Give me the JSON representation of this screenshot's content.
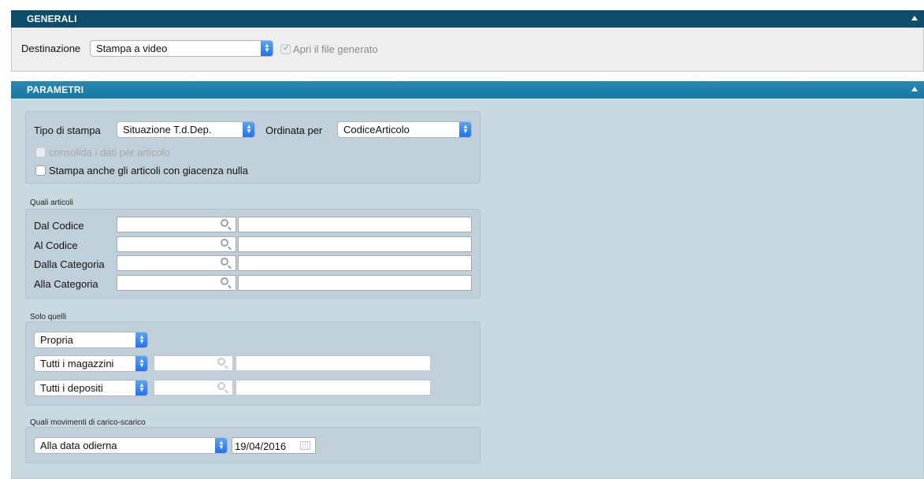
{
  "generali": {
    "title": "GENERALI",
    "destinazione_label": "Destinazione",
    "destinazione_value": "Stampa a video",
    "apri_file_label": "Apri il file generato",
    "apri_file_checked": true
  },
  "parametri": {
    "title": "PARAMETRI",
    "tipo_stampa_label": "Tipo di stampa",
    "tipo_stampa_value": "Situazione T.d.Dep.",
    "ordinata_per_label": "Ordinata per",
    "ordinata_per_value": "CodiceArticolo",
    "consolida_label": "consolida i dati per articolo",
    "stampa_nulla_label": "Stampa anche gli articoli con giacenza nulla",
    "quali_articoli": {
      "title": "Quali articoli",
      "rows": [
        {
          "label": "Dal Codice",
          "code": "",
          "desc": ""
        },
        {
          "label": "Al Codice",
          "code": "",
          "desc": ""
        },
        {
          "label": "Dalla Categoria",
          "code": "",
          "desc": ""
        },
        {
          "label": "Alla Categoria",
          "code": "",
          "desc": ""
        }
      ]
    },
    "solo_quelli": {
      "title": "Solo quelli",
      "propria_value": "Propria",
      "magazzini_value": "Tutti i magazzini",
      "depositi_value": "Tutti i depositi"
    },
    "movimenti": {
      "title": "Quali movimenti di carico-scarico",
      "data_value": "Alla data odierna",
      "date": "19/04/2016"
    }
  },
  "icons": {
    "collapse": "triangle-up-icon",
    "search": "magnifier-icon",
    "select": "updown-chevron-icon",
    "calendar": "calendar-icon"
  }
}
